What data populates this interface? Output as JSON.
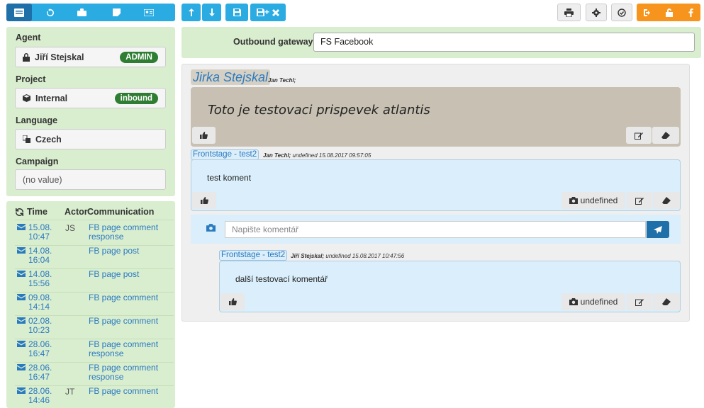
{
  "toolbar": {
    "tabs": [
      "list-icon",
      "history-icon",
      "briefcase-icon",
      "note-icon",
      "contact-card-icon"
    ],
    "actions_left": [
      "move-up-icon",
      "move-down-icon",
      "save-icon",
      "save-close-icon"
    ],
    "actions_right": [
      "print-icon",
      "gear-icon",
      "check-circle-icon"
    ],
    "actions_orange": [
      "logout-icon",
      "unlock-icon",
      "facebook-icon"
    ],
    "save_close_plus": "+"
  },
  "agent": {
    "label": "Agent",
    "name": "Jiří Stejskal",
    "badge": "ADMIN"
  },
  "project": {
    "label": "Project",
    "name": "Internal",
    "badge": "inbound"
  },
  "language": {
    "label": "Language",
    "name": "Czech"
  },
  "campaign": {
    "label": "Campaign",
    "value": "(no value)"
  },
  "history": {
    "col_time": "Time",
    "col_actor": "Actor",
    "col_comm": "Communication",
    "rows": [
      {
        "time": "15.08.",
        "time2": "10:47",
        "actor": "JS",
        "comm": "FB page comment",
        "comm2": "response"
      },
      {
        "time": "14.08.",
        "time2": "16:04",
        "actor": "",
        "comm": "FB page post",
        "comm2": ""
      },
      {
        "time": "14.08.",
        "time2": "15:56",
        "actor": "",
        "comm": "FB page post",
        "comm2": ""
      },
      {
        "time": "09.08.",
        "time2": "14:14",
        "actor": "",
        "comm": "FB page comment",
        "comm2": ""
      },
      {
        "time": "02.08.",
        "time2": "10:23",
        "actor": "",
        "comm": "FB page comment",
        "comm2": ""
      },
      {
        "time": "28.06.",
        "time2": "16:47",
        "actor": "",
        "comm": "FB page comment",
        "comm2": "response"
      },
      {
        "time": "28.06.",
        "time2": "16:47",
        "actor": "",
        "comm": "FB page comment",
        "comm2": "response"
      },
      {
        "time": "28.06.",
        "time2": "14:46",
        "actor": "JT",
        "comm": "FB page comment",
        "comm2": ""
      }
    ]
  },
  "gateway": {
    "label": "Outbound gateway",
    "value": "FS Facebook"
  },
  "post": {
    "author": "Jirka Stejskal",
    "meta": "Jan Techl;",
    "text": "Toto je testovaci prispevek atlantis"
  },
  "comment1": {
    "source": "Frontstage - test2",
    "meta_bold": "Jan Techl;",
    "meta": "undefined 15.08.2017 09:57:05",
    "text": "test koment",
    "attachment": "undefined"
  },
  "reply": {
    "placeholder": "Napište komentář"
  },
  "comment2": {
    "source": "Frontstage - test2",
    "meta_bold": "Jiří Stejskal;",
    "meta": "undefined 15.08.2017 10:47:56",
    "text": "další testovací komentář",
    "attachment": "undefined"
  },
  "colors": {
    "accent": "#2aabe2",
    "panel": "#d9edcf",
    "orange": "#f7941d",
    "badge": "#2e7d32"
  }
}
